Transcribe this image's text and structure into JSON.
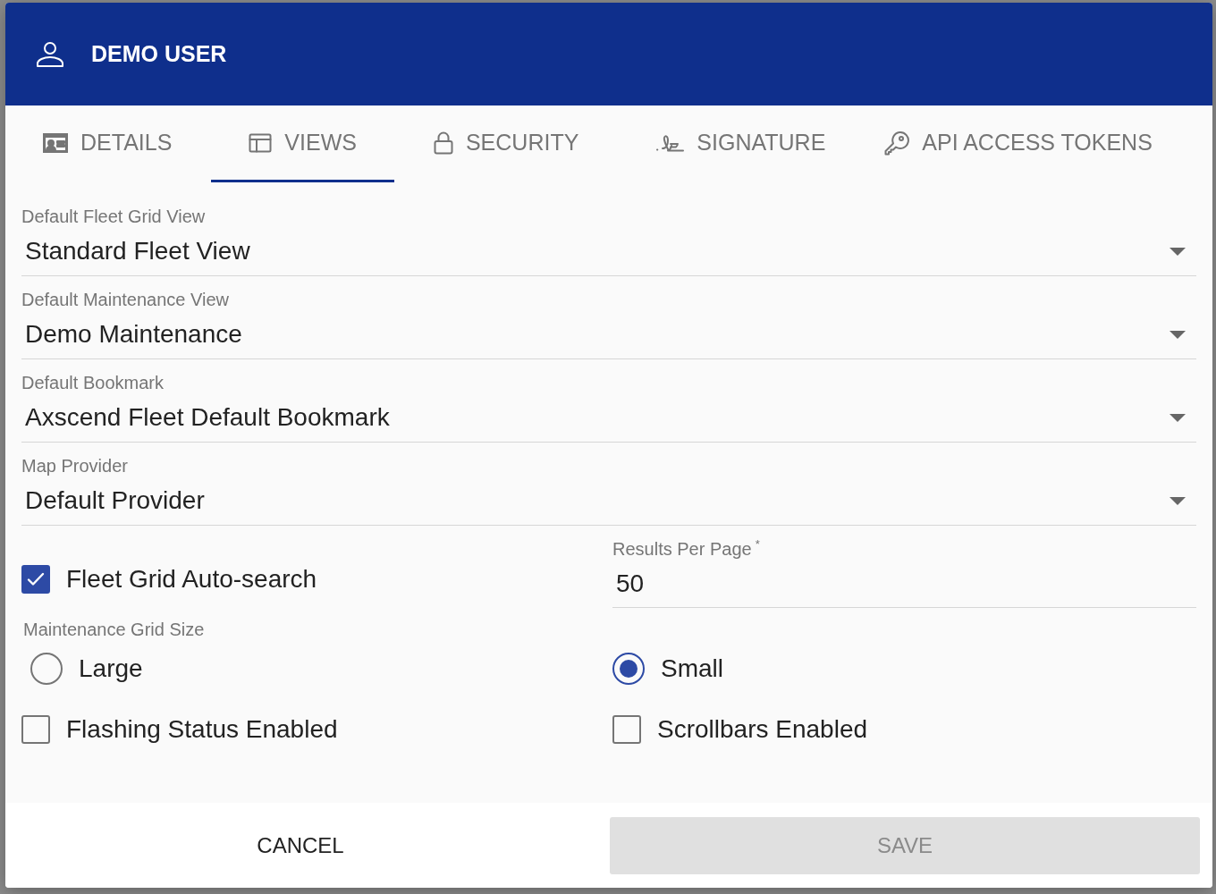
{
  "dialog": {
    "title": "DEMO USER"
  },
  "tabs": [
    {
      "label": "DETAILS",
      "selected": false
    },
    {
      "label": "VIEWS",
      "selected": true
    },
    {
      "label": "SECURITY",
      "selected": false
    },
    {
      "label": "SIGNATURE",
      "selected": false
    },
    {
      "label": "API ACCESS TOKENS",
      "selected": false
    }
  ],
  "selects": [
    {
      "label": "Default Fleet Grid View",
      "value": "Standard Fleet View"
    },
    {
      "label": "Default Maintenance View",
      "value": "Demo Maintenance"
    },
    {
      "label": "Default Bookmark",
      "value": "Axscend Fleet Default Bookmark"
    },
    {
      "label": "Map Provider",
      "value": "Default Provider"
    }
  ],
  "auto_search": {
    "label": "Fleet Grid Auto-search",
    "checked": true
  },
  "results_per_page": {
    "label": "Results Per Page",
    "required_mark": "*",
    "value": "50"
  },
  "grid_size": {
    "label": "Maintenance Grid Size",
    "options": [
      {
        "label": "Large",
        "selected": false
      },
      {
        "label": "Small",
        "selected": true
      }
    ]
  },
  "checkboxes": [
    {
      "label": "Flashing Status Enabled",
      "checked": false
    },
    {
      "label": "Scrollbars Enabled",
      "checked": false
    }
  ],
  "buttons": [
    {
      "label": "CANCEL",
      "disabled": false
    },
    {
      "label": "SAVE",
      "disabled": true
    }
  ]
}
